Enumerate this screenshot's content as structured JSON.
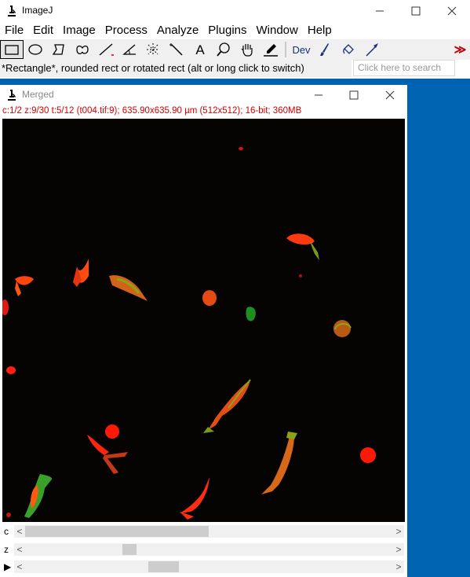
{
  "main_window": {
    "title": "ImageJ",
    "menu": [
      "File",
      "Edit",
      "Image",
      "Process",
      "Analyze",
      "Plugins",
      "Window",
      "Help"
    ],
    "tools": [
      {
        "name": "rectangle-tool-icon",
        "selected": true
      },
      {
        "name": "oval-tool-icon"
      },
      {
        "name": "polygon-tool-icon"
      },
      {
        "name": "freehand-tool-icon"
      },
      {
        "name": "line-tool-icon"
      },
      {
        "name": "angle-tool-icon"
      },
      {
        "name": "point-tool-icon"
      },
      {
        "name": "wand-tool-icon"
      },
      {
        "name": "text-tool-icon",
        "label": "A"
      },
      {
        "name": "magnifier-tool-icon"
      },
      {
        "name": "hand-tool-icon"
      },
      {
        "name": "dropper-tool-icon"
      },
      {
        "name": "dev-tool",
        "label": "Dev"
      },
      {
        "name": "brush-tool-icon"
      },
      {
        "name": "flood-fill-tool-icon"
      },
      {
        "name": "arrow-tool-icon"
      },
      {
        "name": "more-tools-icon",
        "label": "≫"
      }
    ],
    "status": "*Rectangle*, rounded rect or rotated rect (alt or long click to switch)",
    "search_placeholder": "Click here to search"
  },
  "image_window": {
    "title": "Merged",
    "info": "c:1/2 z:9/30 t:5/12 (t004.tif:9); 635.90x635.90 µm (512x512); 16-bit; 360MB",
    "channel_label": "c",
    "slice_label": "z",
    "frame_label": "▶",
    "sliders": [
      {
        "name": "channel-scrollbar",
        "position": 0.5
      },
      {
        "name": "slice-scrollbar",
        "position": 0.3
      },
      {
        "name": "frame-scrollbar",
        "position": 0.36
      }
    ]
  },
  "colors": {
    "desktop": "#0063b1",
    "info_text": "#d40000",
    "red_channel": "#ff2a00",
    "green_channel": "#2bb52b"
  }
}
